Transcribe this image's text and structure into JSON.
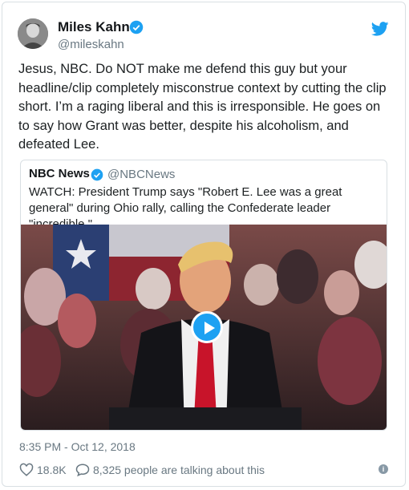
{
  "author": {
    "name": "Miles Kahn",
    "handle": "@mileskahn"
  },
  "tweet_text": "Jesus, NBC. Do NOT make me defend this guy but your headline/clip completely misconstrue context by cutting the clip short. I’m a raging liberal and this is irresponsible. He goes on to say how Grant was better, despite his alcoholism, and defeated Lee.",
  "quoted": {
    "name": "NBC News",
    "handle": "@NBCNews",
    "text": "WATCH: President Trump says \"Robert E. Lee was a great general\" during Ohio rally, calling the Confederate leader \"incredible.\""
  },
  "timestamp": "8:35 PM - Oct 12, 2018",
  "footer": {
    "likes": "18.8K",
    "talking": "8,325 people are talking about this",
    "info_glyph": "i"
  },
  "colors": {
    "accent": "#1da1f2",
    "muted": "#697882",
    "text": "#1c2022",
    "border": "#d9dfe3"
  },
  "icons": {
    "verified": "verified-badge-icon",
    "bird": "twitter-bird-icon",
    "heart": "heart-icon",
    "bubble": "reply-bubble-icon",
    "info": "info-icon",
    "play": "play-icon"
  }
}
